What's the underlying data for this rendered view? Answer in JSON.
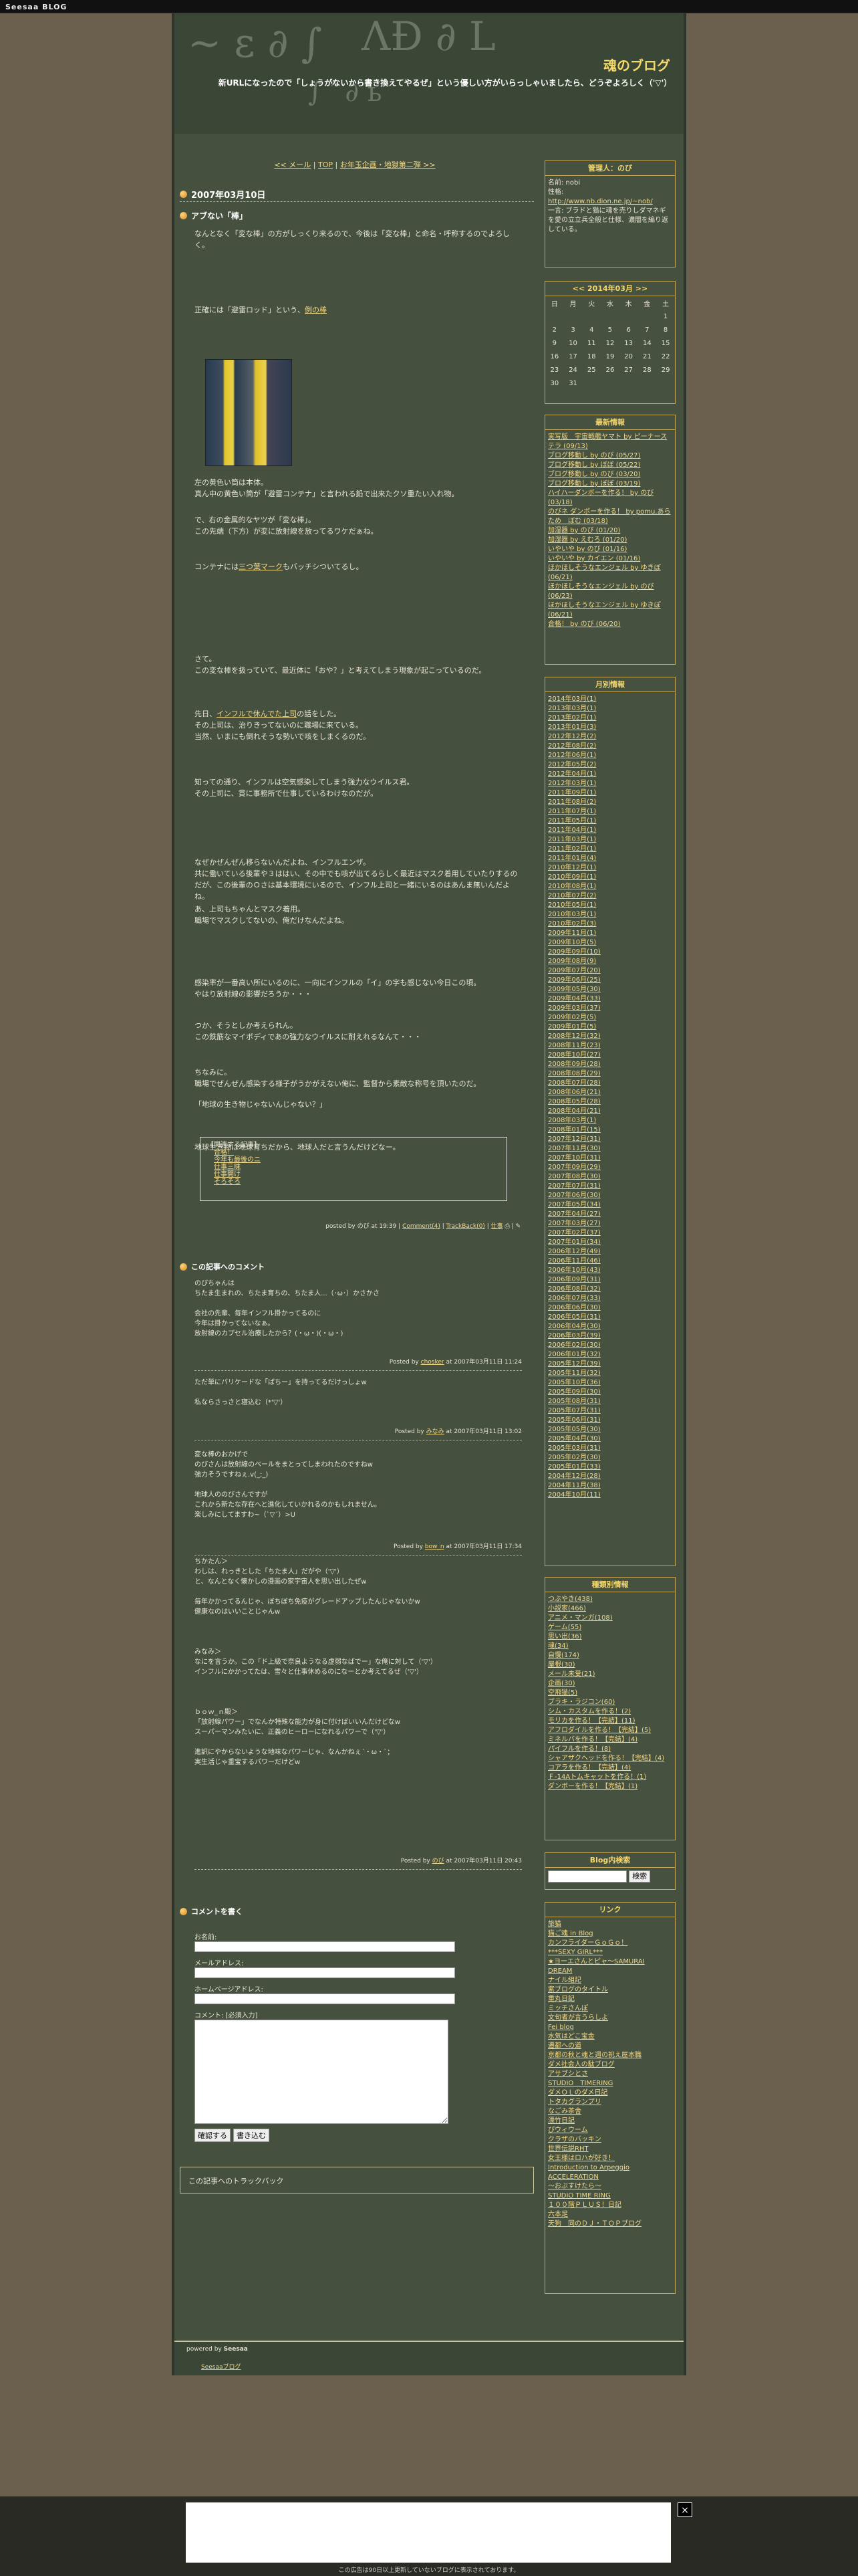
{
  "topbar": {
    "logo": "Seesaa BLOG"
  },
  "header": {
    "title": "魂のブログ",
    "description": "新URLになったので「しょうがないから書き換えてやるぜ」という優しい方がいらっしゃいましたら、どうぞよろしく（'▽'）"
  },
  "nav": {
    "prev": "<< メール",
    "top": "TOP",
    "next": "お年玉企画・地獄第二弾 >>"
  },
  "entry": {
    "date": "2007年03月10日",
    "title": "アブない「棒」",
    "paragraphs": [
      "なんとなく「変な棒」の方がしっくり来るので、今後は「変な棒」と命名・呼称するのでよろしく。",
      "正確には「避雷ロッド」という、",
      "左の黄色い筒は本体。\n真ん中の黄色い筒が「避雷コンテナ」と言われる鉛で出来たクソ重たい入れ物。",
      "で、右の金属的なヤツが「変な棒」。\nこの先端（下方）が変に放射線を放ってるワケだぁね。",
      "コンテナには",
      "さて。\nこの変な棒を扱っていて、最近体に「おや？」と考えてしまう現象が起こっているのだ。",
      "先日、",
      "の話をした。\nその上司は、治りきってないのに職場に来ている。\n当然、いまにも倒れそうな勢いで咳をしまくるのだ。",
      "知っての通り、インフルは空気感染してしまう強力なウイルス君。\nその上司に、賞に事務所で仕事しているわけなのだが。",
      "なぜかぜんぜん移らないんだよね、インフルエンザ。\n共に働いている後輩や３ははい、その中でも咳が出てるらしく最近はマスク着用していたりするのだが、この後輩のＯさは基本環境にいるので、インフル上司と一緒にいるのはあんま無いんだよね。",
      "あ、上司もちゃんとマスク着用。\n職場でマスクしてないの、俺だけなんだよね。",
      "感染率が一番高い所にいるのに、一向にインフルの「イ」の字も感じない今日この頃。\nやはり放射線の影響だろうか・・・",
      "つか、そうとしか考えられん。\nこの鉄筋なマイボディであの強力なウイルスに耐えれるなんて・・・",
      "ちなみに。\n職場でぜんぜん感染する様子がうかがえない俺に、監督から素敵な称号を頂いたのだ。",
      "「地球の生き物じゃないんじゃない？」",
      "地球生き物は地球育ちだから、地球人だと言うんだけどなー。"
    ],
    "link1": "例の棒",
    "link2": "三つ葉マーク",
    "link3": "インフルで休んでた上司",
    "tail2": "もバッチシついてるし。",
    "related_title": "【関連する記事】",
    "related": [
      "合格！",
      "今年も最後のニ",
      "仕事三昧",
      "仕事開け",
      "そろそろ"
    ],
    "posted": "posted by のび at 19:39",
    "comments_link": "Comment(4)",
    "tb_link": "TrackBack(0)",
    "category_link": "仕事"
  },
  "comments": {
    "heading": "この記事へのコメント",
    "items": [
      {
        "text": "のびちゃんは\nちたま生まれの、ちたま育ちの、ちたま人...（･ω･）かさかさ\n\n会社の先輩、毎年インフル掛かってるのに\n今年は掛かってないなぁ。\n放射線のカプセル治療したから？(・ω・)(・ω・)",
        "by": "Posted by",
        "name": "chosker",
        "at": " at 2007年03月11日 11:24"
      },
      {
        "text": "ただ単にバリケードな「ばちー」を持ってるだけっしょw\n\n私ならさっさと寝込む（*'▽'）",
        "by": "Posted by",
        "name": "みなみ",
        "at": " at 2007年03月11日 13:02"
      },
      {
        "text": "変な棒のおかげで\nのびさんは放射線のベールをまとってしまわれたのですねw\n強力そうですねぇ.v(_;_)\n\n地球人ののびさんですが\nこれから新たな存在へと進化していかれるのかもしれません。\n楽しみにしてますわ~（`▽´）>U",
        "by": "Posted by",
        "name": "bow_n",
        "at": " at 2007年03月11日 17:34"
      },
      {
        "text": "ちかたん＞\nわしは、れっきとした「ちたま人」だがや（'▽'）\nと、なんとなく懐かしの漫画の家宇宙人を思い出したぜw\n\n毎年かかってるんじゃ、ぼちぼち免疫がグレードアップしたんじゃないかw\n健康なのはいいことじゃんw\n\n\n\nみなみ＞\nなにを言うか。この「ド上級で奈良ようなる虚弱なばでー」な俺に対して（'▽'）\nインフルにかかってたは、雪々と仕事休めるのになーとか考えてるぜ（'▽'）\n\n\n\nｂｏｗ_ｎ殿＞\n「放射線パワー」でなんか特殊な能力が身に付けばいいんだけどなw\nスーパーマンみたいに、正義のヒーローになれるパワーで（'▽'）\n\n進訳にやからないような地味なパワーじゃ、なんかねぇ´・ω・`；\n実生活じゃ重宝するパワーだけどw",
        "by": "Posted by",
        "name": "のび",
        "at": " at 2007年03月11日 20:43"
      }
    ]
  },
  "comment_form": {
    "heading": "コメントを書く",
    "name_label": "お名前:",
    "email_label": "メールアドレス:",
    "homepage_label": "ホームページアドレス:",
    "comment_label": "コメント: [必須入力]",
    "confirm": "確認する",
    "submit": "書き込む"
  },
  "trackback": {
    "label": "この記事へのトラックバック"
  },
  "sidebar": {
    "admin": {
      "title": "管理人：のび",
      "lines": [
        "名前: nobi",
        "性格:",
        "一言: ブラドと猫に魂を売りしダマネギを愛の立立兵全般と仕様、濃闇を編り返している。"
      ],
      "link": "http://www.nb.dion.ne.jp/~nob/"
    },
    "calendar": {
      "title": "<< 2014年03月 >>",
      "weekdays": [
        "日",
        "月",
        "火",
        "水",
        "木",
        "金",
        "土"
      ],
      "rows": [
        [
          "",
          "",
          "",
          "",
          "",
          "",
          "1"
        ],
        [
          "2",
          "3",
          "4",
          "5",
          "6",
          "7",
          "8"
        ],
        [
          "9",
          "10",
          "11",
          "12",
          "13",
          "14",
          "15"
        ],
        [
          "16",
          "17",
          "18",
          "19",
          "20",
          "21",
          "22"
        ],
        [
          "23",
          "24",
          "25",
          "26",
          "27",
          "28",
          "29"
        ],
        [
          "30",
          "31",
          "",
          "",
          "",
          "",
          ""
        ]
      ]
    },
    "recent": {
      "title": "最新情報",
      "items": [
        "実写版　宇宙戦艦ヤマト by ピーナーステラ (09/13)",
        "ブログ移動し by のび (05/27)",
        "ブログ移動し by ぼぼ (05/22)",
        "ブログ移動し by のび (03/20)",
        "ブログ移動し by ぼぼ (03/19)",
        "ハイハーダンボーを作る！ by のび (03/18)",
        "のびネ ダンボーを作る！ by pomu.あらため　ぼむ (03/18)",
        "加湿器 by のび (01/20)",
        "加湿器 by えむろ (01/20)",
        "いやいや by のび (01/16)",
        "いやいや by カイエン (01/16)",
        "ほかほしそうなエンジェル by ゆきぽ (06/21)",
        "ほかほしそうなエンジェル by のび (06/23)",
        "ほかほしそうなエンジェル by ゆきぽ (06/21)",
        "合格！ by のび (06/20)"
      ]
    },
    "archives": {
      "title": "月別情報",
      "items": [
        "2014年03月(1)",
        "2013年03月(1)",
        "2013年02月(1)",
        "2013年01月(3)",
        "2012年12月(2)",
        "2012年08月(2)",
        "2012年06月(1)",
        "2012年05月(2)",
        "2012年04月(1)",
        "2012年03月(1)",
        "2011年09月(1)",
        "2011年08月(2)",
        "2011年07月(1)",
        "2011年05月(1)",
        "2011年04月(1)",
        "2011年03月(1)",
        "2011年02月(1)",
        "2011年01月(4)",
        "2010年12月(1)",
        "2010年09月(1)",
        "2010年08月(1)",
        "2010年07月(2)",
        "2010年05月(1)",
        "2010年03月(1)",
        "2010年02月(3)",
        "2009年11月(1)",
        "2009年10月(5)",
        "2009年09月(10)",
        "2009年08月(9)",
        "2009年07月(20)",
        "2009年06月(25)",
        "2009年05月(30)",
        "2009年04月(33)",
        "2009年03月(37)",
        "2009年02月(5)",
        "2009年01月(5)",
        "2008年12月(32)",
        "2008年11月(23)",
        "2008年10月(27)",
        "2008年09月(28)",
        "2008年08月(29)",
        "2008年07月(28)",
        "2008年06月(21)",
        "2008年05月(28)",
        "2008年04月(21)",
        "2008年03月(1)",
        "2008年01月(15)",
        "2007年12月(31)",
        "2007年11月(30)",
        "2007年10月(31)",
        "2007年09月(29)",
        "2007年08月(30)",
        "2007年07月(31)",
        "2007年06月(30)",
        "2007年05月(34)",
        "2007年04月(27)",
        "2007年03月(27)",
        "2007年02月(37)",
        "2007年01月(34)",
        "2006年12月(49)",
        "2006年11月(46)",
        "2006年10月(43)",
        "2006年09月(31)",
        "2006年08月(32)",
        "2006年07月(33)",
        "2006年06月(30)",
        "2006年05月(31)",
        "2006年04月(30)",
        "2006年03月(39)",
        "2006年02月(30)",
        "2006年01月(32)",
        "2005年12月(39)",
        "2005年11月(32)",
        "2005年10月(36)",
        "2005年09月(30)",
        "2005年08月(31)",
        "2005年07月(31)",
        "2005年06月(31)",
        "2005年05月(30)",
        "2005年04月(30)",
        "2005年03月(31)",
        "2005年02月(30)",
        "2005年01月(33)",
        "2004年12月(28)",
        "2004年11月(38)",
        "2004年10月(11)"
      ]
    },
    "categories": {
      "title": "種類別情報",
      "items": [
        "つぶやき(438)",
        "小説家(466)",
        "アニメ・マンガ(108)",
        "ゲーム(55)",
        "思い出(36)",
        "魂(34)",
        "自慢(174)",
        "屋根(30)",
        "メール未受(21)",
        "企画(30)",
        "空飛猫(5)",
        "ブラキ・ラジコン(60)",
        "シム・カスタムを作る！(2)",
        "モリカを作る！【完結】(11)",
        "アフロダイルを作る！【完結】(5)",
        "ミネルバを作る！【完結】(4)",
        "パイフルを作る！(8)",
        "シャアザクヘッドを作る！【完結】(4)",
        "コアラを作る！【完結】(4)",
        "Ｆ-14Aトムキャットを作る！(1)",
        "ダンボーを作る！【完結】(1)"
      ]
    },
    "search": {
      "title": "Blog内検索",
      "button": "検索"
    },
    "links": {
      "title": "リンク",
      "items": [
        "旅猫",
        "猫ご魂 in Blog",
        "カンフライダーＧｏＧｏ！",
        "***SEXY GIRL***",
        "★ヨーエさんとピャ〜SAMURAI",
        "DREAM",
        "ナイル組記",
        "紫ブログのタイトル",
        "重丸日記",
        "ミッチさんぽ",
        "文句者が言うらしよ",
        "Fei blog",
        "水気はどこ宝金",
        "遷都への道",
        "京都の秋と魂と週の祝え屋本職",
        "ダメ社会人の駄ブログ",
        "アサブシとさ",
        "STUDIO　TIMERING",
        "ダメＯＬのダメ日記",
        "トタカグランプリ",
        "なごみ茶舎",
        "漂竹日記",
        "ぴウィウーム",
        "クラザのバッキン",
        "世界伝説RHT",
        "女王様はロハが好き！",
        "Introduction to Arpeggio",
        "ACCELERATION",
        "〜おぶすけたら〜",
        "STUDIO TIME RING",
        "１００階ＰＬＵＳ！日記",
        "六本足",
        "天狗　同のＤＪ・ＴＯＰブログ"
      ]
    }
  },
  "footer": {
    "powered": "powered by",
    "brand": "Seesaa",
    "sublink": "Seesaaブログ"
  },
  "ad": {
    "close": "×",
    "note": "この広告は90日以上更新していないブログに表示されております。"
  }
}
